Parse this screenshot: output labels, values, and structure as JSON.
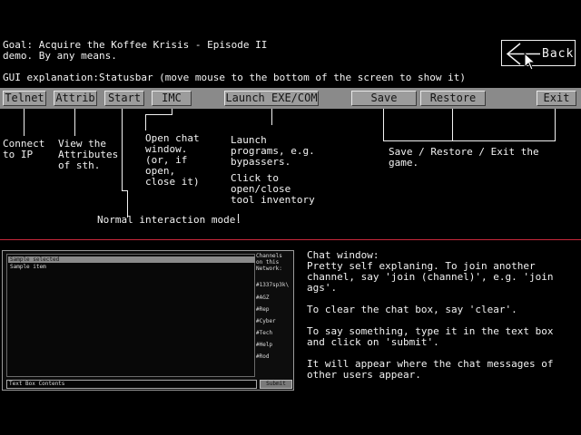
{
  "goal": {
    "line1": "Goal: Acquire the Koffee Krisis - Episode II",
    "line2": "demo. By any means."
  },
  "gui_explanation": "GUI explanation:Statusbar (move mouse to the bottom of the screen to show it)",
  "back_label": "Back",
  "statusbar": {
    "buttons": [
      {
        "label": "Telnet"
      },
      {
        "label": "Attrib"
      },
      {
        "label": "Start"
      },
      {
        "label": "IMC"
      },
      {
        "label": "Launch EXE/COM"
      },
      {
        "label": "Save"
      },
      {
        "label": "Restore"
      },
      {
        "label": "Exit"
      }
    ]
  },
  "annotations": {
    "telnet": "Connect\nto IP",
    "attrib": "View the\nAttributes\nof sth.",
    "imc": "Open chat\nwindow.\n(or, if\nopen,\nclose it)",
    "launch1": "Launch\nprograms, e.g.\nbypassers.",
    "launch2": "Click to\nopen/close\ntool inventory",
    "save_restore_exit": "Save / Restore / Exit the\ngame.",
    "start": "Normal interaction mode."
  },
  "chat": {
    "list_items": [
      "Sample selected",
      "Sample item"
    ],
    "channels_header": "Channels\non this\nNetwork:",
    "channels": [
      "#1337sp3k\\",
      "#AGZ",
      "#Rep",
      "#Cyber",
      "#Tech",
      "#Help",
      "#Rod"
    ],
    "input_value": "Text Box Contents",
    "submit_label": "Submit"
  },
  "chat_help": {
    "p1": "Chat window:\nPretty self explaning. To join another\nchannel, say 'join (channel)', e.g. 'join\nags'.",
    "p2": "To clear the chat box, say 'clear'.",
    "p3": "To say something, type it in the text box\nand click on 'submit'.",
    "p4": "It will appear where the chat messages of\nother users appear."
  }
}
